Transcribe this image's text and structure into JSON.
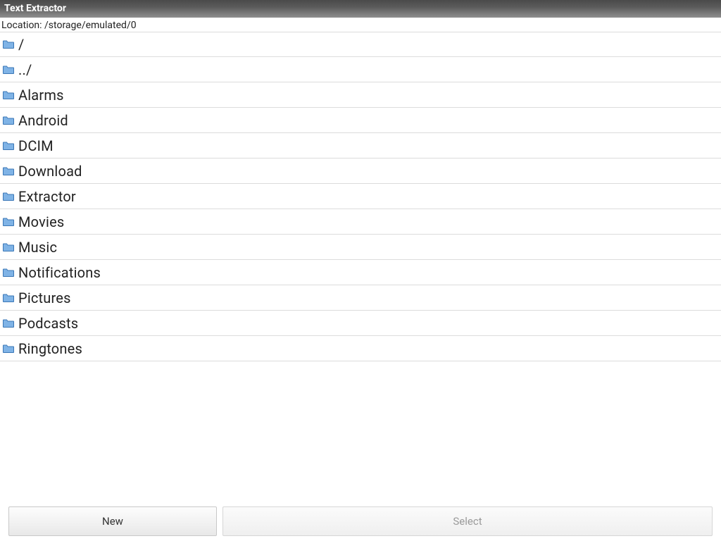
{
  "header": {
    "title": "Text Extractor"
  },
  "location": {
    "prefix": "Location: ",
    "path": "/storage/emulated/0"
  },
  "folders": [
    {
      "label": "/"
    },
    {
      "label": "../"
    },
    {
      "label": "Alarms"
    },
    {
      "label": "Android"
    },
    {
      "label": "DCIM"
    },
    {
      "label": "Download"
    },
    {
      "label": "Extractor"
    },
    {
      "label": "Movies"
    },
    {
      "label": "Music"
    },
    {
      "label": "Notifications"
    },
    {
      "label": "Pictures"
    },
    {
      "label": "Podcasts"
    },
    {
      "label": "Ringtones"
    }
  ],
  "buttons": {
    "new": "New",
    "select": "Select"
  },
  "icon_colors": {
    "folder_fill": "#7fb3e6",
    "folder_stroke": "#3b77b6"
  }
}
